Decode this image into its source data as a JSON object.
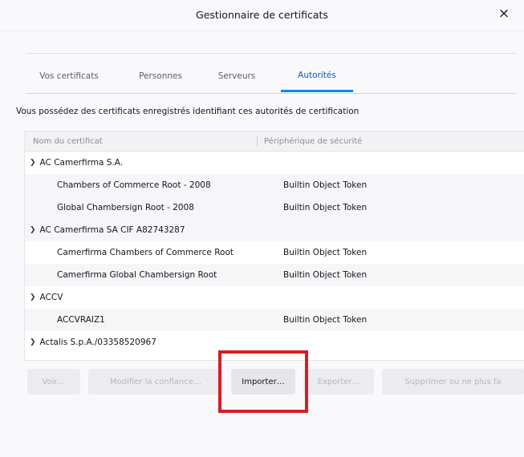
{
  "window": {
    "title": "Gestionnaire de certificats",
    "close_glyph": "×"
  },
  "tabs": [
    {
      "label": "Vos certificats",
      "active": false
    },
    {
      "label": "Personnes",
      "active": false
    },
    {
      "label": "Serveurs",
      "active": false
    },
    {
      "label": "Autorités",
      "active": true
    }
  ],
  "description": "Vous possédez des certificats enregistrés identifiant ces autorités de certification",
  "table": {
    "columns": [
      "Nom du certificat",
      "Périphérique de sécurité"
    ],
    "rows": [
      {
        "name": "AC Camerfirma S.A.",
        "device": "",
        "type": "group",
        "expanded": true
      },
      {
        "name": "Chambers of Commerce Root - 2008",
        "device": "Builtin Object Token",
        "type": "item"
      },
      {
        "name": "Global Chambersign Root - 2008",
        "device": "Builtin Object Token",
        "type": "item"
      },
      {
        "name": "AC Camerfirma SA CIF A82743287",
        "device": "",
        "type": "group",
        "expanded": true
      },
      {
        "name": "Camerfirma Chambers of Commerce Root",
        "device": "Builtin Object Token",
        "type": "item"
      },
      {
        "name": "Camerfirma Global Chambersign Root",
        "device": "Builtin Object Token",
        "type": "item"
      },
      {
        "name": "ACCV",
        "device": "",
        "type": "group",
        "expanded": true
      },
      {
        "name": "ACCVRAIZ1",
        "device": "Builtin Object Token",
        "type": "item"
      },
      {
        "name": "Actalis S.p.A./03358520967",
        "device": "",
        "type": "group",
        "expanded": true
      }
    ]
  },
  "buttons": {
    "view": "Voir…",
    "edit_trust": "Modifier la confiance…",
    "import": "Importer…",
    "export": "Exporter…",
    "delete": "Supprimer ou ne plus fa"
  },
  "icons": {
    "chevron": "chevron-down-icon"
  },
  "colors": {
    "accent": "#0a84ff",
    "highlight": "#d31f26"
  }
}
